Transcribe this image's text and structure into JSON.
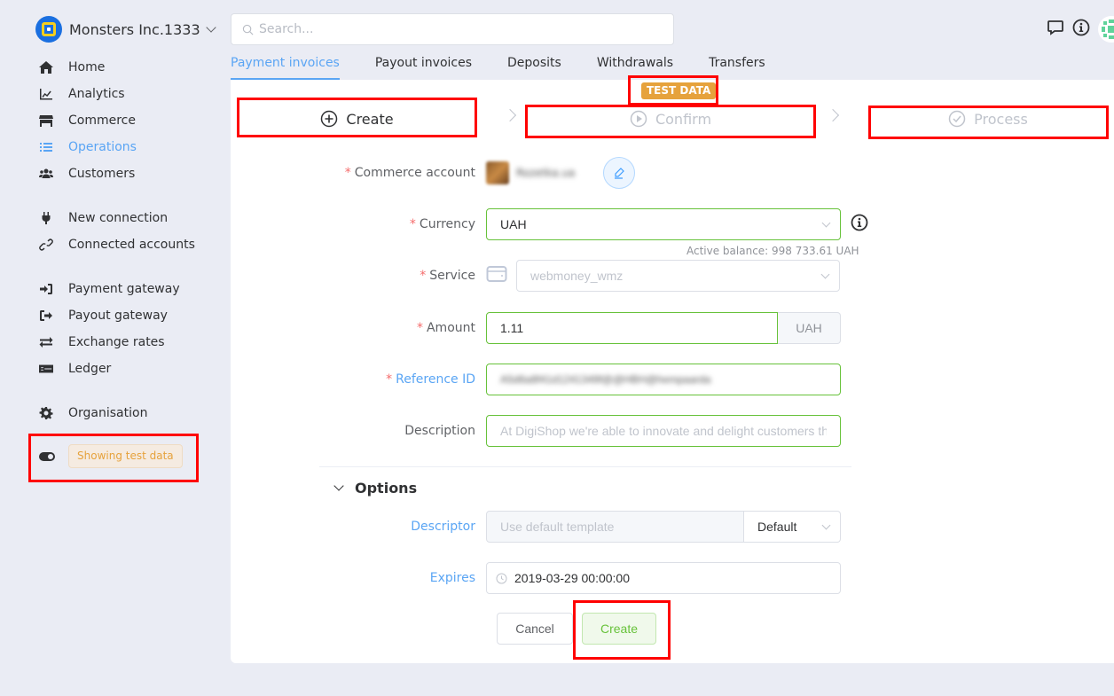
{
  "org": {
    "name": "Monsters Inc.1333"
  },
  "sidebar": {
    "items": [
      {
        "label": "Home",
        "icon": "home-icon"
      },
      {
        "label": "Analytics",
        "icon": "analytics-icon"
      },
      {
        "label": "Commerce",
        "icon": "store-icon"
      },
      {
        "label": "Operations",
        "icon": "list-icon",
        "active": true
      },
      {
        "label": "Customers",
        "icon": "users-icon"
      },
      {
        "label": "New connection",
        "icon": "plug-icon"
      },
      {
        "label": "Connected accounts",
        "icon": "link-icon"
      },
      {
        "label": "Payment gateway",
        "icon": "sign-in-icon"
      },
      {
        "label": "Payout gateway",
        "icon": "sign-out-icon"
      },
      {
        "label": "Exchange rates",
        "icon": "exchange-icon"
      },
      {
        "label": "Ledger",
        "icon": "ledger-icon"
      },
      {
        "label": "Organisation",
        "icon": "gear-icon"
      }
    ],
    "test_data_label": "Showing test data"
  },
  "header": {
    "search_placeholder": "Search..."
  },
  "tabs": [
    {
      "label": "Payment invoices",
      "active": true
    },
    {
      "label": "Payout invoices"
    },
    {
      "label": "Deposits"
    },
    {
      "label": "Withdrawals"
    },
    {
      "label": "Transfers"
    }
  ],
  "badge": "TEST DATA",
  "steps": [
    {
      "label": "Create",
      "state": "current"
    },
    {
      "label": "Confirm",
      "state": "pending"
    },
    {
      "label": "Process",
      "state": "pending"
    }
  ],
  "form": {
    "commerce_account": {
      "label": "Commerce account",
      "value": "Rozetka.ua"
    },
    "currency": {
      "label": "Currency",
      "value": "UAH",
      "balance": "Active balance: 998 733.61 UAH"
    },
    "service": {
      "label": "Service",
      "value": "webmoney_wmz"
    },
    "amount": {
      "label": "Amount",
      "value": "1.11",
      "suffix": "UAH"
    },
    "reference_id": {
      "label": "Reference ID",
      "value": "A5d6a8f41d1241349f@@HBH@hempaarda"
    },
    "description": {
      "label": "Description",
      "placeholder": "At DigiShop we're able to innovate and delight customers th"
    },
    "options_title": "Options",
    "descriptor": {
      "label": "Descriptor",
      "placeholder": "Use default template",
      "select": "Default"
    },
    "expires": {
      "label": "Expires",
      "value": "2019-03-29 00:00:00"
    },
    "cancel_label": "Cancel",
    "create_label": "Create"
  }
}
